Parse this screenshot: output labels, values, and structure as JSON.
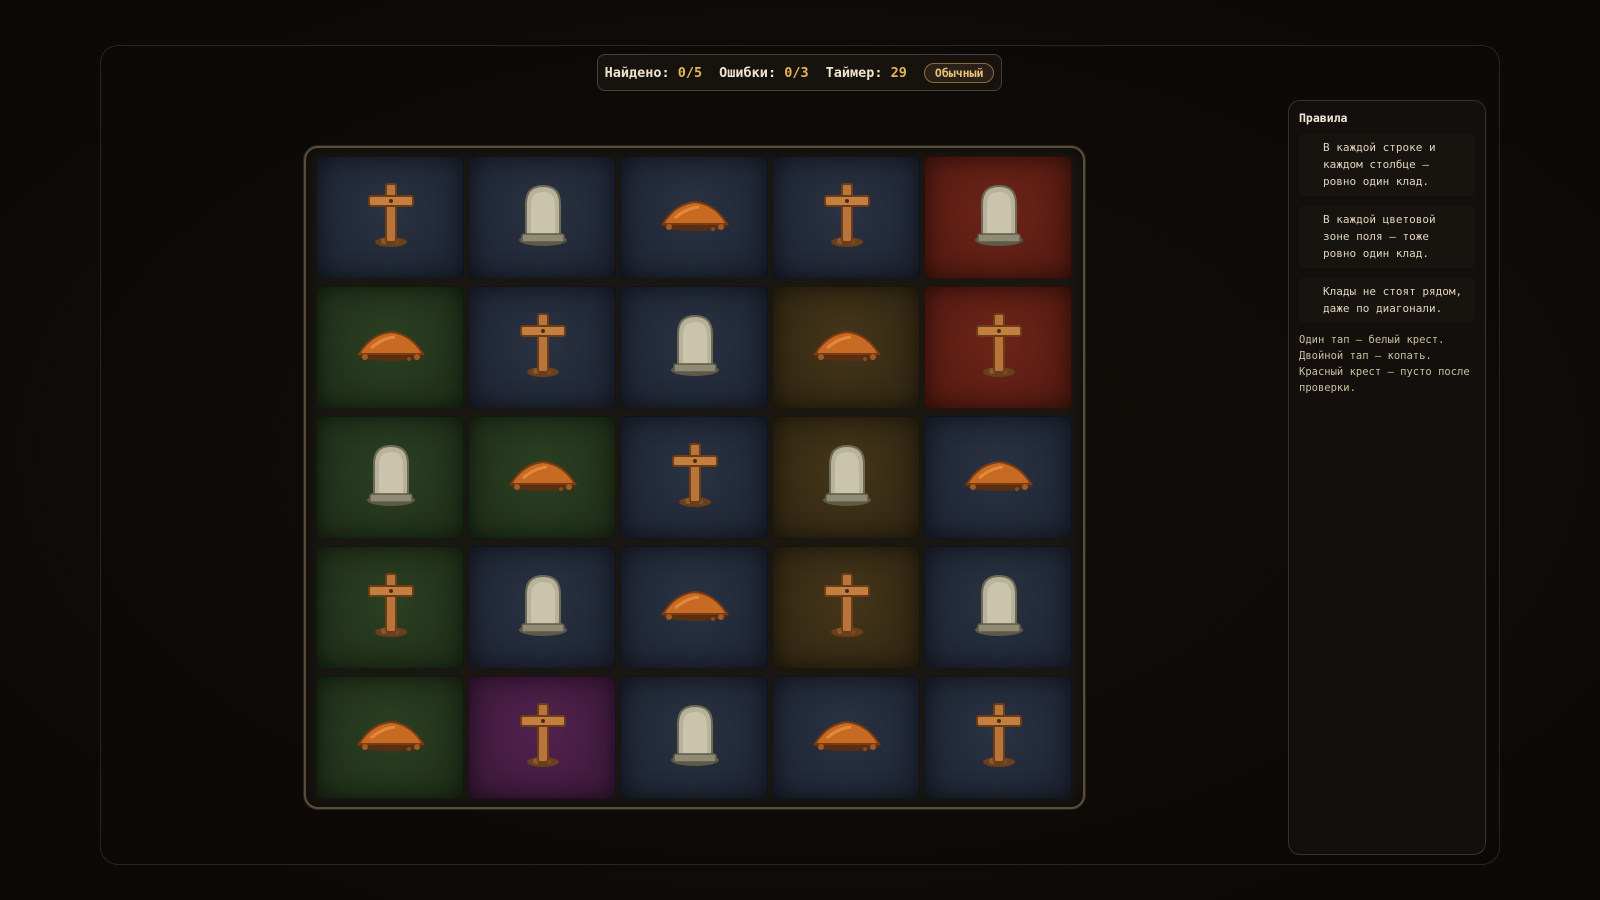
{
  "hud": {
    "found_label": "Найдено:",
    "found_value": "0/5",
    "errors_label": "Ошибки:",
    "errors_value": "0/3",
    "timer_label": "Таймер:",
    "timer_value": "29",
    "mode": "Обычный"
  },
  "board": {
    "rows": [
      [
        {
          "zone": "blue",
          "icon": "cross"
        },
        {
          "zone": "blue",
          "icon": "tombstone"
        },
        {
          "zone": "blue",
          "icon": "dirt-mound"
        },
        {
          "zone": "blue",
          "icon": "cross"
        },
        {
          "zone": "red",
          "icon": "tombstone"
        }
      ],
      [
        {
          "zone": "green",
          "icon": "dirt-mound"
        },
        {
          "zone": "blue",
          "icon": "cross"
        },
        {
          "zone": "blue",
          "icon": "tombstone"
        },
        {
          "zone": "brown",
          "icon": "dirt-mound"
        },
        {
          "zone": "red",
          "icon": "cross"
        }
      ],
      [
        {
          "zone": "green",
          "icon": "tombstone"
        },
        {
          "zone": "green",
          "icon": "dirt-mound"
        },
        {
          "zone": "blue",
          "icon": "cross"
        },
        {
          "zone": "brown",
          "icon": "tombstone"
        },
        {
          "zone": "blue",
          "icon": "dirt-mound"
        }
      ],
      [
        {
          "zone": "green",
          "icon": "cross"
        },
        {
          "zone": "blue",
          "icon": "tombstone"
        },
        {
          "zone": "blue",
          "icon": "dirt-mound"
        },
        {
          "zone": "brown",
          "icon": "cross"
        },
        {
          "zone": "blue",
          "icon": "tombstone"
        }
      ],
      [
        {
          "zone": "green",
          "icon": "dirt-mound"
        },
        {
          "zone": "purple",
          "icon": "cross"
        },
        {
          "zone": "blue",
          "icon": "tombstone"
        },
        {
          "zone": "blue",
          "icon": "dirt-mound"
        },
        {
          "zone": "blue",
          "icon": "cross"
        }
      ]
    ]
  },
  "rules": {
    "title": "Правила",
    "items": [
      "В каждой строке и каждом столбце — ровно один клад.",
      "В каждой цветовой зоне поля — тоже ровно один клад.",
      "Клады не стоят рядом, даже по диагонали."
    ],
    "hint": "Один тап — белый крест. Двойной тап — копать. Красный крест — пусто после проверки."
  },
  "colors": {
    "accent": "#e8b45a",
    "zone_blue": "#252d3c",
    "zone_green": "#263a1e",
    "zone_brown": "#3d3018",
    "zone_red": "#621f15",
    "zone_purple": "#4a1f47"
  }
}
